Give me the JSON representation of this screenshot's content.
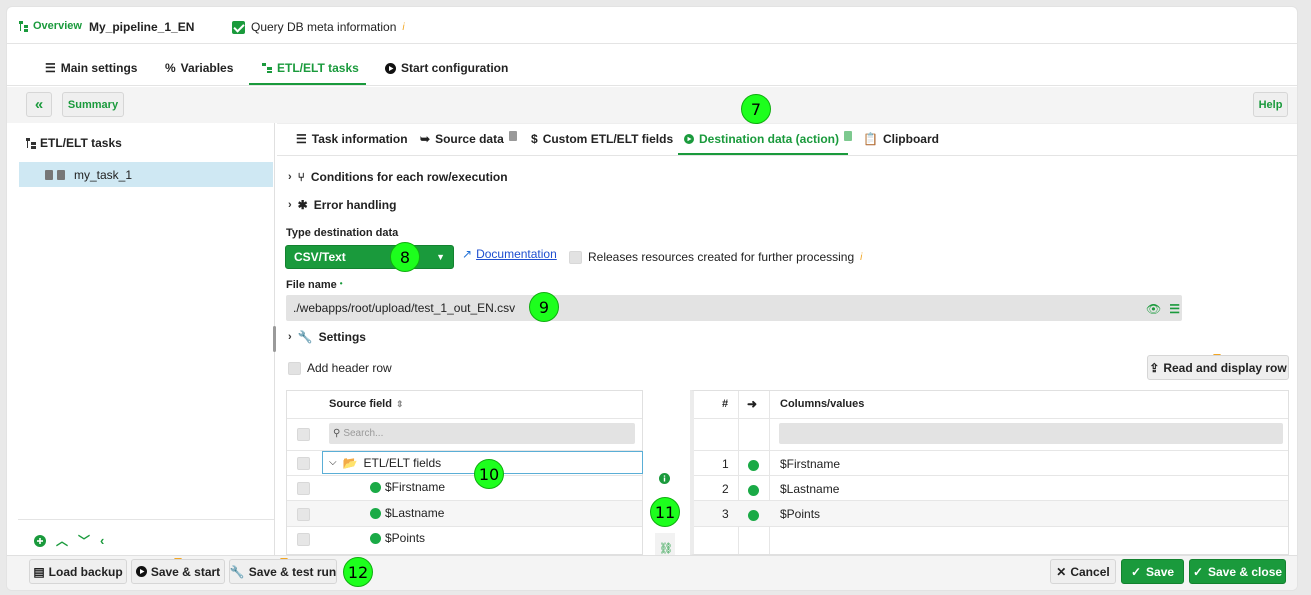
{
  "header": {
    "overview_label": "Overview",
    "pipeline_name": "My_pipeline_1_EN",
    "query_db_label": "Query DB meta information",
    "info_icon": "i"
  },
  "main_tabs": [
    {
      "label": "Main settings",
      "icon": "list-icon"
    },
    {
      "label": "Variables",
      "icon": "percent-icon"
    },
    {
      "label": "ETL/ELT tasks",
      "icon": "tree-icon",
      "active": true
    },
    {
      "label": "Start configuration",
      "icon": "play-icon"
    }
  ],
  "toolbar": {
    "collapse_glyph": "«",
    "summary_label": "Summary",
    "help_label": "Help"
  },
  "sidebar": {
    "title": "ETL/ELT tasks",
    "items": [
      {
        "label": "my_task_1"
      }
    ]
  },
  "sub_tabs": [
    {
      "label": "Task information"
    },
    {
      "label": "Source data"
    },
    {
      "label": "Custom ETL/ELT fields"
    },
    {
      "label": "Destination data (action)",
      "active": true
    },
    {
      "label": "Clipboard"
    }
  ],
  "sections": {
    "conditions_label": "Conditions for each row/execution",
    "error_handling_label": "Error handling",
    "settings_label": "Settings"
  },
  "destination": {
    "type_label": "Type destination data",
    "type_value": "CSV/Text",
    "documentation_label": "Documentation",
    "releases_label": "Releases resources created for further processing",
    "file_name_label": "File name",
    "required_mark": "•",
    "file_name_value": "./webapps/root/upload/test_1_out_EN.csv",
    "add_header_label": "Add header row",
    "read_display_label": "Read and display row"
  },
  "source_table": {
    "header": "Source field",
    "search_placeholder": "Search...",
    "group_label": "ETL/ELT fields",
    "fields": [
      "$Firstname",
      "$Lastname",
      "$Points"
    ]
  },
  "dest_table": {
    "col_num": "#",
    "col_arrow": "➜",
    "col_values": "Columns/values",
    "rows": [
      {
        "num": "1",
        "value": "$Firstname"
      },
      {
        "num": "2",
        "value": "$Lastname"
      },
      {
        "num": "3",
        "value": "$Points"
      }
    ]
  },
  "markers": [
    "7",
    "8",
    "9",
    "10",
    "11",
    "12"
  ],
  "footer": {
    "load_backup": "Load backup",
    "save_start": "Save & start",
    "save_test": "Save & test run",
    "cancel": "Cancel",
    "save": "Save",
    "save_close": "Save & close"
  },
  "colors": {
    "accent": "#1a9a3c",
    "marker": "#1dff1d",
    "selected_row": "#cfe8f3"
  }
}
